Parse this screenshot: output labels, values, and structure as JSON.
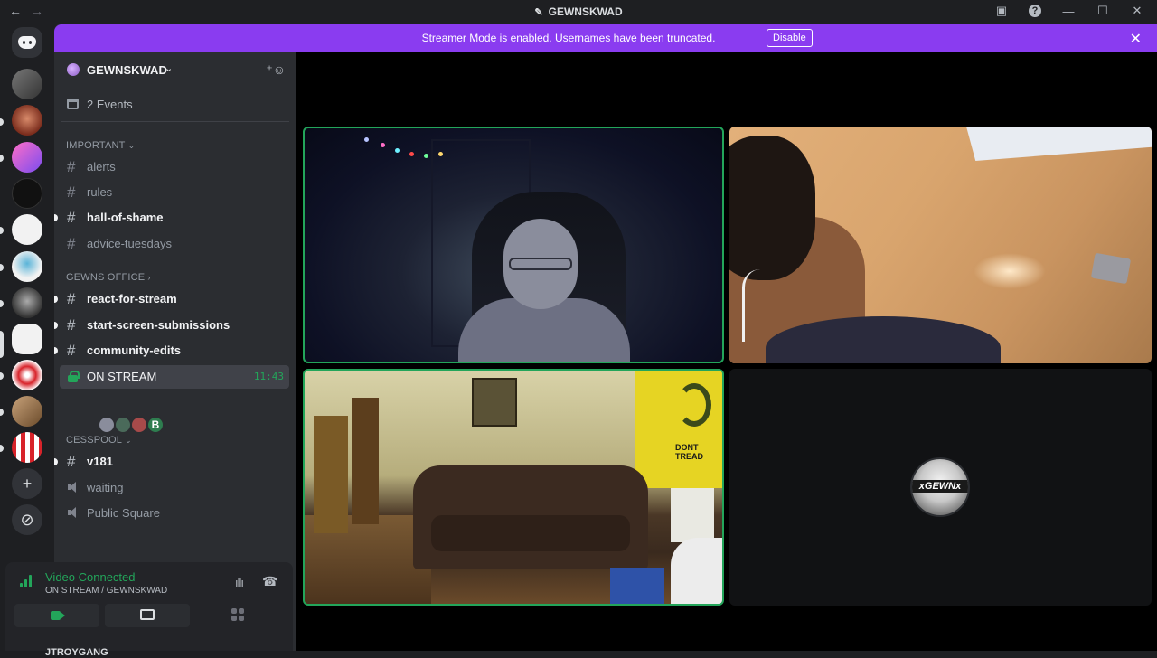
{
  "titlebar": {
    "back": "←",
    "forward": "→",
    "title": "GEWNSKWAD",
    "help": "?",
    "minimize": "—",
    "maximize": "☐",
    "close": "✕"
  },
  "banner": {
    "text": "Streamer Mode is enabled. Usernames have been truncated.",
    "disable_label": "Disable",
    "close": "✕"
  },
  "server": {
    "name": "GEWNSKWAD",
    "events_label": "2 Events"
  },
  "categories": [
    {
      "label": "IMPORTANT",
      "chev": "⌄"
    },
    {
      "label": "GEWNS OFFICE",
      "chev": "›"
    },
    {
      "label": "CESSPOOL",
      "chev": "⌄"
    }
  ],
  "channels": {
    "important": [
      {
        "name": "alerts",
        "unread": false
      },
      {
        "name": "rules",
        "unread": false
      },
      {
        "name": "hall-of-shame",
        "unread": true
      },
      {
        "name": "advice-tuesdays",
        "unread": false
      }
    ],
    "office": [
      {
        "name": "react-for-stream",
        "unread": true
      },
      {
        "name": "start-screen-submissions",
        "unread": true
      },
      {
        "name": "community-edits",
        "unread": true
      }
    ],
    "voice_active": {
      "name": "ON STREAM",
      "timer": "11:43",
      "user_badge": "B"
    },
    "cesspool": [
      {
        "name": "v181",
        "type": "text",
        "unread": true
      },
      {
        "name": "waiting",
        "type": "voice"
      },
      {
        "name": "Public Square",
        "type": "voice"
      }
    ]
  },
  "voice_panel": {
    "status": "Video Connected",
    "location": "ON STREAM / GEWNSKWAD",
    "bottom_user": "JTROYGANG"
  },
  "tiles": {
    "flag_text": "DONT TREAD",
    "avatar_text": "xGEWNx"
  },
  "colors": {
    "accent_banner": "#8a3cf0",
    "speaking": "#23a55a",
    "sidebar": "#2b2d31"
  }
}
